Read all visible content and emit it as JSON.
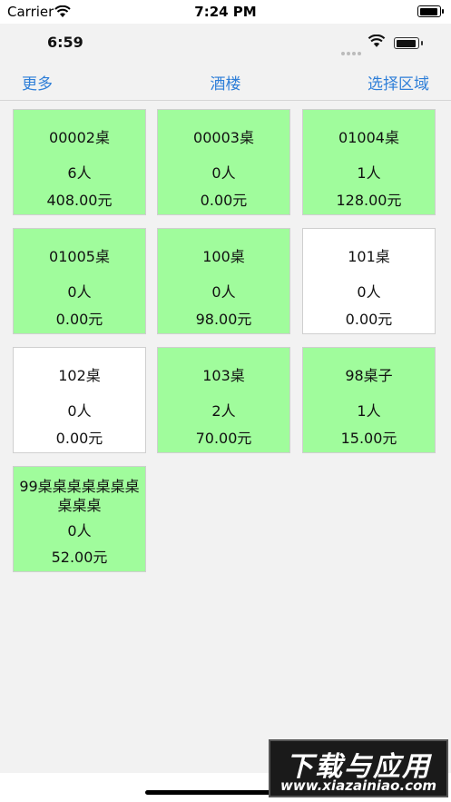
{
  "outer_status": {
    "carrier": "Carrier",
    "time": "7:24 PM"
  },
  "inner_status": {
    "time": "6:59"
  },
  "navbar": {
    "left": "更多",
    "title": "酒楼",
    "right": "选择区域"
  },
  "tables": [
    {
      "name": "00002桌",
      "people": "6人",
      "amount": "408.00元",
      "occupied": true
    },
    {
      "name": "00003桌",
      "people": "0人",
      "amount": "0.00元",
      "occupied": true
    },
    {
      "name": "01004桌",
      "people": "1人",
      "amount": "128.00元",
      "occupied": true
    },
    {
      "name": "01005桌",
      "people": "0人",
      "amount": "0.00元",
      "occupied": true
    },
    {
      "name": "100桌",
      "people": "0人",
      "amount": "98.00元",
      "occupied": true
    },
    {
      "name": "101桌",
      "people": "0人",
      "amount": "0.00元",
      "occupied": false
    },
    {
      "name": "102桌",
      "people": "0人",
      "amount": "0.00元",
      "occupied": false
    },
    {
      "name": "103桌",
      "people": "2人",
      "amount": "70.00元",
      "occupied": true
    },
    {
      "name": "98桌子",
      "people": "1人",
      "amount": "15.00元",
      "occupied": true
    },
    {
      "name": "99桌桌桌桌桌桌桌桌桌桌",
      "people": "0人",
      "amount": "52.00元",
      "occupied": true
    }
  ],
  "colors": {
    "occupied": "#a0fc9c",
    "free": "#ffffff",
    "accent": "#2f7fd8"
  },
  "watermark": {
    "main": "下载与应用",
    "sub": "www.xiazainiao.com"
  }
}
